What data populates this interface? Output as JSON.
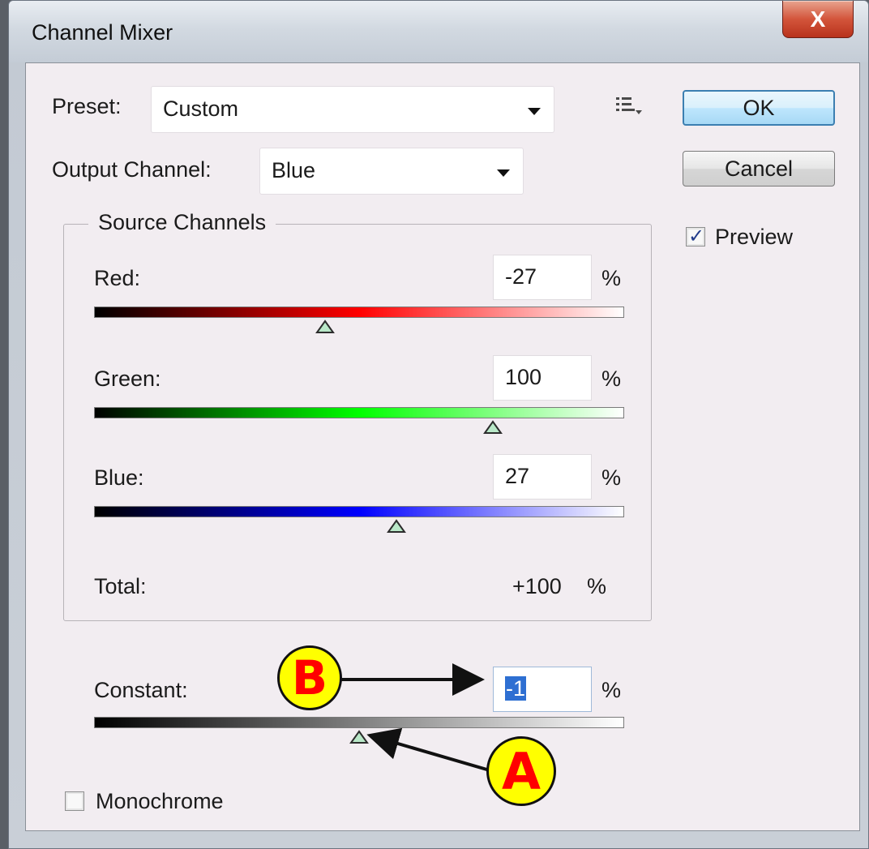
{
  "window": {
    "title": "Channel Mixer",
    "close_label": "X"
  },
  "preset": {
    "label": "Preset:",
    "value": "Custom"
  },
  "output_channel": {
    "label": "Output Channel:",
    "value": "Blue"
  },
  "buttons": {
    "ok": "OK",
    "cancel": "Cancel"
  },
  "preview": {
    "label": "Preview",
    "checked": true
  },
  "source_channels": {
    "title": "Source Channels",
    "channels": [
      {
        "label": "Red:",
        "value": "-27",
        "unit": "%",
        "slider_percent": -27
      },
      {
        "label": "Green:",
        "value": "100",
        "unit": "%",
        "slider_percent": 100
      },
      {
        "label": "Blue:",
        "value": "27",
        "unit": "%",
        "slider_percent": 27
      }
    ],
    "total": {
      "label": "Total:",
      "value": "+100",
      "unit": "%"
    }
  },
  "constant": {
    "label": "Constant:",
    "value": "-1",
    "unit": "%",
    "slider_percent": -1
  },
  "monochrome": {
    "label": "Monochrome",
    "checked": false
  },
  "annotations": {
    "a": "A",
    "b": "B"
  },
  "colors": {
    "ok_border": "#3c7fb1",
    "close_red": "#c73b22",
    "badge_fill": "#ffff00",
    "badge_text": "#ff0000",
    "selection": "#2e6fd2"
  },
  "icons": {
    "close": "close-icon",
    "menu": "panel-menu-icon",
    "dropdown": "chevron-down-icon",
    "slider_thumb": "slider-thumb-icon"
  }
}
